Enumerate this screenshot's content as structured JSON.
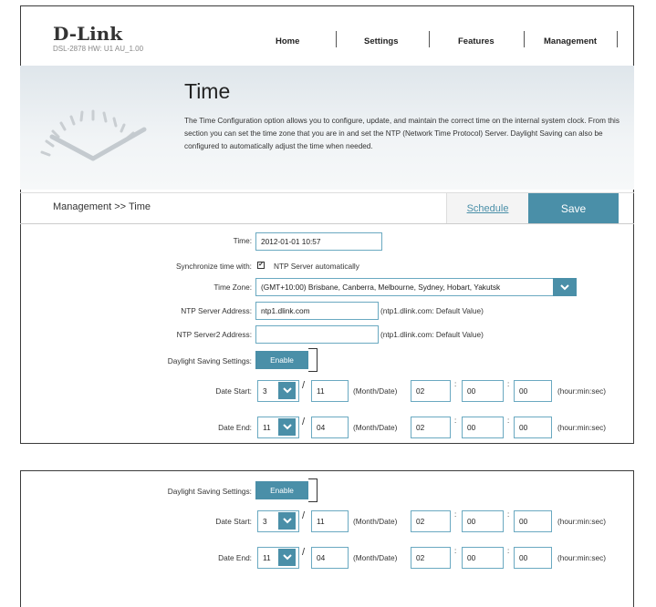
{
  "header": {
    "logo": "D-Link",
    "logo_sub": "DSL-2878 HW: U1 AU_1.00",
    "nav": [
      "Home",
      "Settings",
      "Features",
      "Management"
    ]
  },
  "hero": {
    "title": "Time",
    "description": "The Time Configuration option allows you to configure, update, and maintain the correct time on the internal system clock. From this section you can set the time zone that you are in and set the NTP (Network Time Protocol) Server. Daylight Saving can also be configured to automatically adjust the time when needed."
  },
  "bar": {
    "breadcrumb": "Management >> Time",
    "schedule_label": "Schedule",
    "save_label": "Save"
  },
  "form": {
    "time_label": "Time:",
    "time_value": "2012-01-01 10:57",
    "sync_label": "Synchronize time with:",
    "sync_checked": true,
    "sync_value": "NTP Server automatically",
    "tz_label": "Time Zone:",
    "tz_value": "(GMT+10:00) Brisbane, Canberra, Melbourne, Sydney, Hobart, Yakutsk",
    "ntp1_label": "NTP Server Address:",
    "ntp1_value": "ntp1.dlink.com",
    "ntp1_note": "(ntp1.dlink.com: Default Value)",
    "ntp2_label": "NTP Server2 Address:",
    "ntp2_value": "",
    "ntp2_note": "(ntp1.dlink.com: Default Value)",
    "dst_label": "Daylight Saving Settings:",
    "dst_button": "Enable"
  },
  "dst": {
    "start_label": "Date Start:",
    "start_month": "3",
    "start_date": "11",
    "end_label": "Date End:",
    "end_month": "11",
    "end_date": "04",
    "month_date_note": "(Month/Date)",
    "hour": "02",
    "min": "00",
    "sec": "00",
    "hms_note": "(hour:min:sec)"
  },
  "colors": {
    "accent": "#4a8fa8",
    "input_border": "#6aa9c1"
  }
}
